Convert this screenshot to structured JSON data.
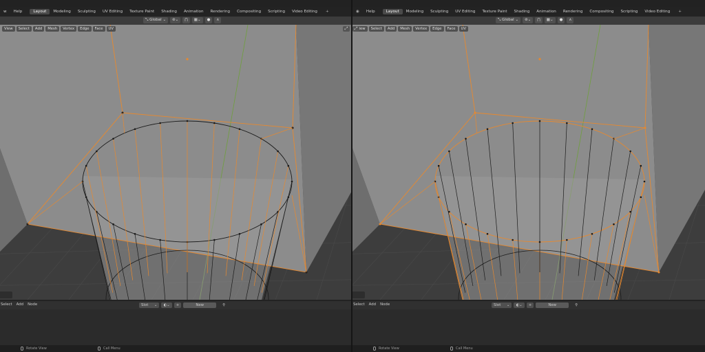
{
  "panes": [
    {
      "id": "left",
      "topbar": {
        "menus": [
          "w",
          "Help"
        ],
        "tabs": [
          "Layout",
          "Modeling",
          "Sculpting",
          "UV Editing",
          "Texture Paint",
          "Shading",
          "Animation",
          "Rendering",
          "Compositing",
          "Scripting",
          "Video Editing"
        ],
        "active_tab": "Layout",
        "add_tab": "+"
      },
      "toolbar": {
        "orientation": "Global",
        "proportional": "∧"
      },
      "viewport_menu": [
        "View",
        "Select",
        "Add",
        "Mesh",
        "Vertex",
        "Edge",
        "Face",
        "UV"
      ],
      "node_editor": {
        "menus": [
          "Select",
          "Add",
          "Node"
        ],
        "slot_label": "Slot",
        "new_label": "New"
      },
      "status": {
        "rotate": "Rotate View",
        "call_menu": "Call Menu"
      }
    },
    {
      "id": "right",
      "topbar": {
        "menus": [
          "Help"
        ],
        "tabs": [
          "Layout",
          "Modeling",
          "Sculpting",
          "UV Editing",
          "Texture Paint",
          "Shading",
          "Animation",
          "Rendering",
          "Compositing",
          "Scripting",
          "Video Editing"
        ],
        "active_tab": "Layout",
        "add_tab": "+"
      },
      "toolbar": {
        "orientation": "Global",
        "proportional": "∧"
      },
      "viewport_menu": [
        "View",
        "Select",
        "Add",
        "Mesh",
        "Vertex",
        "Edge",
        "Face",
        "UV"
      ],
      "node_editor": {
        "menus": [
          "Select",
          "Add",
          "Node"
        ],
        "slot_label": "Slot",
        "new_label": "New"
      },
      "status": {
        "rotate": "Rotate View",
        "call_menu": "Call Menu"
      }
    }
  ],
  "colors": {
    "selection": "#e8892e",
    "wire": "#1a1a1a",
    "face": "#8a8a8a",
    "background": "#3d3d3d",
    "y_axis": "#6fa03c"
  }
}
